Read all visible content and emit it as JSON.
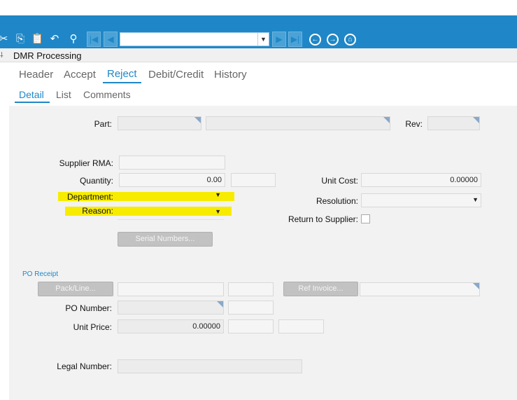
{
  "toolbar": {
    "icons": [
      "scissors-icon",
      "copy-icon",
      "paste-icon",
      "undo-icon",
      "binoculars-icon"
    ],
    "nav_first": "first-record-icon",
    "nav_prev": "previous-record-icon",
    "nav_next": "next-record-icon",
    "nav_last": "last-record-icon",
    "nav_value": "",
    "back": "back-icon",
    "forward": "forward-icon",
    "home": "home-icon"
  },
  "window": {
    "title": "DMR Processing"
  },
  "tabs": {
    "main": [
      "Header",
      "Accept",
      "Reject",
      "Debit/Credit",
      "History"
    ],
    "active_main": "Reject",
    "sub": [
      "Detail",
      "List",
      "Comments"
    ],
    "active_sub": "Detail"
  },
  "form": {
    "part_label": "Part:",
    "part_value": "",
    "part_desc": "",
    "rev_label": "Rev:",
    "rev_value": "",
    "supplier_rma_label": "Supplier RMA:",
    "supplier_rma_value": "",
    "quantity_label": "Quantity:",
    "quantity_value": "0.00",
    "quantity_uom": "",
    "unit_cost_label": "Unit Cost:",
    "unit_cost_value": "0.00000",
    "department_label": "Department:",
    "department_value": "",
    "resolution_label": "Resolution:",
    "resolution_value": "",
    "reason_label": "Reason:",
    "reason_value": "",
    "return_label": "Return to Supplier:",
    "return_checked": false,
    "serial_button": "Serial Numbers..."
  },
  "po_receipt": {
    "section_label": "PO Receipt",
    "packline_button": "Pack/Line...",
    "ref_invoice_button": "Ref Invoice...",
    "po_number_label": "PO Number:",
    "unit_price_label": "Unit Price:",
    "unit_price_value": "0.00000",
    "legal_number_label": "Legal Number:"
  },
  "colors": {
    "accent": "#1f87c7",
    "highlight": "#f7ec00"
  }
}
